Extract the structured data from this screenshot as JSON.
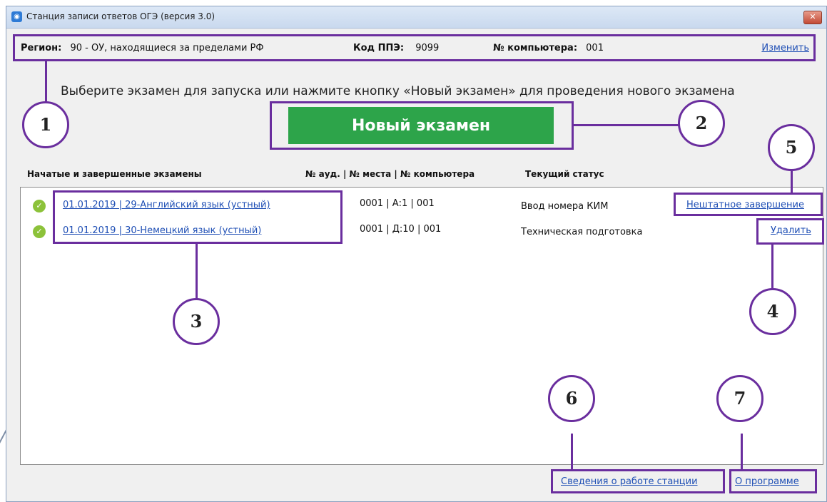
{
  "window": {
    "title": "Станция записи ответов ОГЭ (версия 3.0)",
    "close_glyph": "✕"
  },
  "info": {
    "region_label": "Регион:",
    "region_value": "90 - ОУ, находящиеся за пределами РФ",
    "ppe_label": "Код ППЭ:",
    "ppe_value": "9099",
    "computer_label": "№ компьютера:",
    "computer_value": "001",
    "change_link": "Изменить"
  },
  "instruction": "Выберите экзамен для запуска или нажмите кнопку «Новый экзамен» для проведения нового экзамена",
  "new_exam_button": "Новый экзамен",
  "columns": {
    "exams": "Начатые и завершенные экзамены",
    "place": "№ ауд. | № места | № компьютера",
    "status": "Текущий статус"
  },
  "exams": [
    {
      "title": "01.01.2019 | 29-Английский язык (устный)",
      "place": "0001 | А:1 | 001",
      "status": "Ввод номера КИМ",
      "action": "Нештатное завершение"
    },
    {
      "title": "01.01.2019 | 30-Немецкий язык (устный)",
      "place": "0001 | Д:10 | 001",
      "status": "Техническая подготовка",
      "action": "Удалить"
    }
  ],
  "footer": {
    "station_info": "Сведения о работе станции",
    "about": "О программе"
  },
  "callouts": [
    "1",
    "2",
    "3",
    "4",
    "5",
    "6",
    "7"
  ],
  "colors": {
    "annotation": "#6a2e9e",
    "button_green": "#2da44a",
    "link_blue": "#1f4fb5",
    "check_green": "#8cc23a"
  }
}
